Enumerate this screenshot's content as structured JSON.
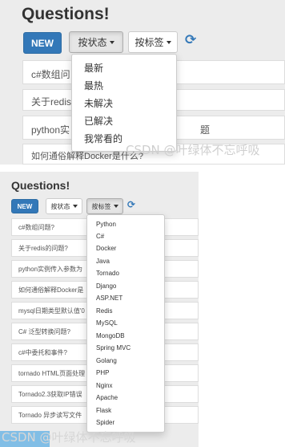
{
  "top": {
    "title": "Questions!",
    "new_label": "NEW",
    "status_label": "按状态",
    "tag_label": "按标签",
    "rows": [
      "c#数组问",
      "关于redis",
      "python实",
      "",
      "如何通俗解释Docker是什么?"
    ],
    "status_menu": [
      "最新",
      "最热",
      "未解决",
      "已解决",
      "我常看的"
    ],
    "row4_tail": "题"
  },
  "bottom": {
    "title": "Questions!",
    "new_label": "NEW",
    "status_label": "按状态",
    "tag_label": "按标签",
    "rows": [
      "c#数组问题?",
      "关于redis的问题?",
      "python实例传入参数为",
      "如何通俗解释Docker是",
      "mysql日期类型默认值'0",
      "C# 泛型转换问题?",
      "c#中委托和事件?",
      "tornado HTML页面处理",
      "Tornado2.3获取IP错误",
      "Tornado 异步读写文件"
    ],
    "tag_menu": [
      "Python",
      "C#",
      "Docker",
      "Java",
      "Tornado",
      "Django",
      "ASP.NET",
      "Redis",
      "MySQL",
      "MongoDB",
      "Spring MVC",
      "Golang",
      "PHP",
      "Nginx",
      "Apache",
      "Flask",
      "Spider"
    ]
  },
  "watermark_top": "CSDN @叶绿体不忘呼吸",
  "watermark_bottom": "CSDN @叶绿体不忘呼吸"
}
